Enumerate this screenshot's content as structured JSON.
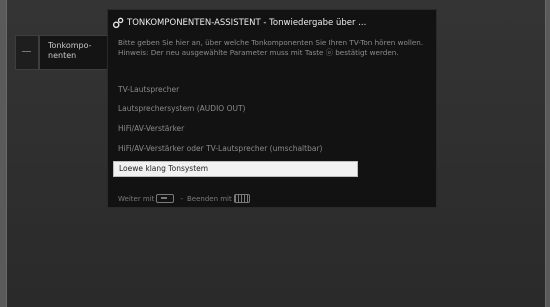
{
  "sidebar": {
    "label": "Tonkompo-\nnenten"
  },
  "dialog": {
    "title": "TONKOMPONENTEN-ASSISTENT - Tonwiedergabe über ...",
    "instruction": "Bitte geben Sie hier an, über welche Tonkomponenten Sie Ihren TV-Ton hören wollen.",
    "hint": "Hinweis: Der neu ausgewählte Parameter muss mit Taste ⓞ bestätigt werden.",
    "options": [
      {
        "label": "TV-Lautsprecher"
      },
      {
        "label": "Lautsprechersystem (AUDIO OUT)"
      },
      {
        "label": "HiFi/AV-Verstärker"
      },
      {
        "label": "HiFi/AV-Verstärker oder TV-Lautsprecher (umschaltbar)"
      },
      {
        "label": "Loewe klang Tonsystem",
        "selected": true
      }
    ],
    "footer": {
      "next_label": "Weiter mit",
      "exit_label": "Beenden mit"
    }
  },
  "icons": {
    "title_icon": "gear-icon",
    "ok_key_icon": "ok-key-icon",
    "end_key_icon": "end-key-icon"
  },
  "colors": {
    "dialog_bg": "#121212",
    "selected_bg": "#f1f1f1",
    "screen_bg": "#343434"
  }
}
